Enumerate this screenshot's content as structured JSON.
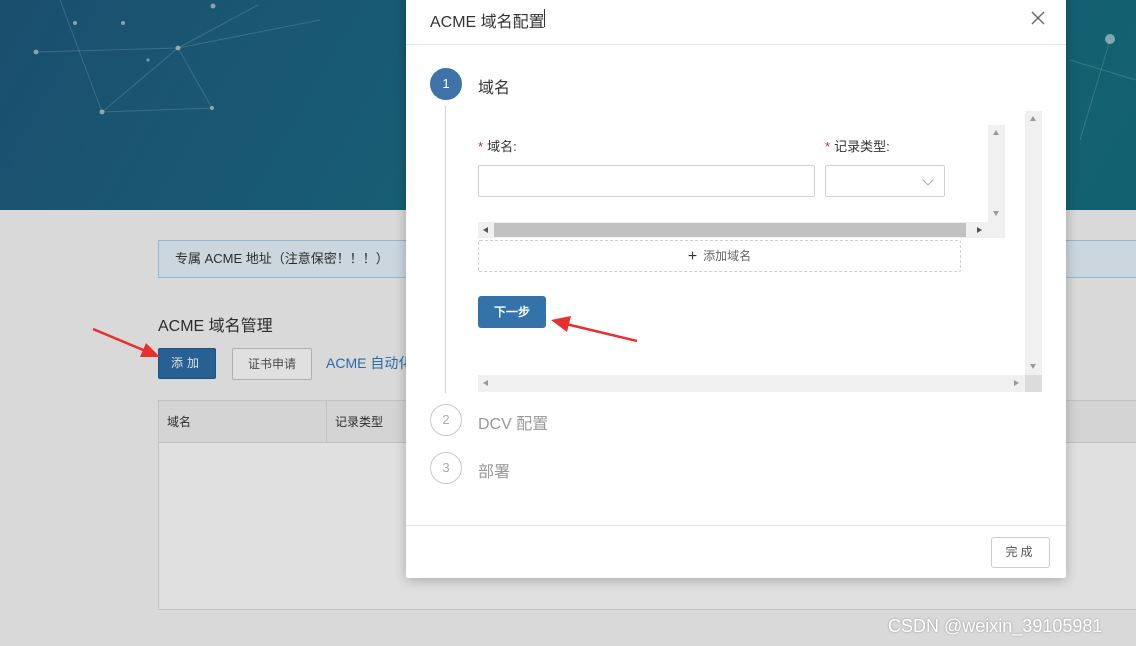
{
  "background": {
    "notice_text": "专属 ACME 地址（注意保密！！！）",
    "section_title": "ACME 域名管理",
    "add_button": "添加",
    "cert_button": "证书申请",
    "auto_link": "ACME 自动化",
    "table_headers": [
      "域名",
      "记录类型"
    ]
  },
  "modal": {
    "title": "ACME 域名配置",
    "close_icon": "close-icon",
    "steps": [
      {
        "number": "1",
        "label": "域名",
        "state": "active"
      },
      {
        "number": "2",
        "label": "DCV 配置",
        "state": "idle"
      },
      {
        "number": "3",
        "label": "部署",
        "state": "idle"
      }
    ],
    "form": {
      "domain_label": "域名:",
      "domain_value": "",
      "record_type_label": "记录类型:",
      "record_type_value": "",
      "required_mark": "*",
      "add_domain_label": "添加域名",
      "add_domain_icon": "plus-icon",
      "next_button": "下一步"
    },
    "finish_button": "完成"
  },
  "watermark": "CSDN @weixin_39105981",
  "colors": {
    "primary": "#3472aa",
    "required": "#e0242c",
    "annotation_arrow": "#e8302f"
  }
}
